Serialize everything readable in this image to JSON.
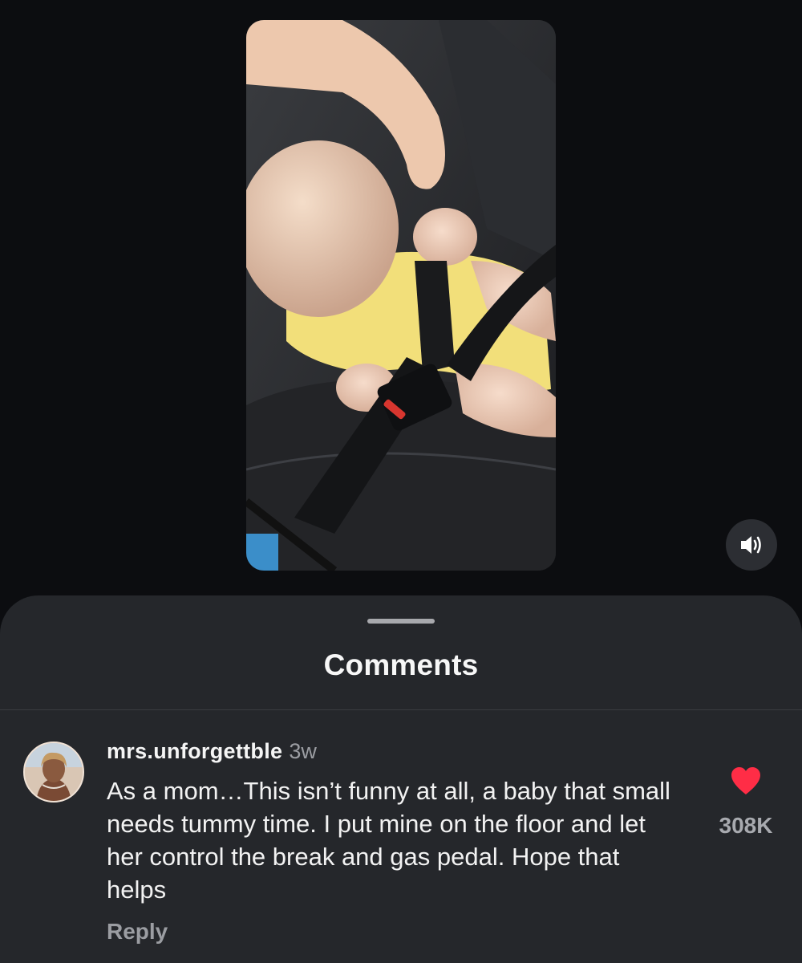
{
  "video": {
    "mute_icon": "speaker-volume-icon"
  },
  "comments_sheet": {
    "title": "Comments"
  },
  "comment": {
    "username": "mrs.unforgettble",
    "time": "3w",
    "text": "As a mom…This isn’t funny at all, a baby that small needs tummy time. I put mine on the floor and let her control the break and gas pedal. Hope that helps",
    "reply_label": "Reply",
    "like_count": "308K",
    "like_color": "#ff2d46"
  }
}
